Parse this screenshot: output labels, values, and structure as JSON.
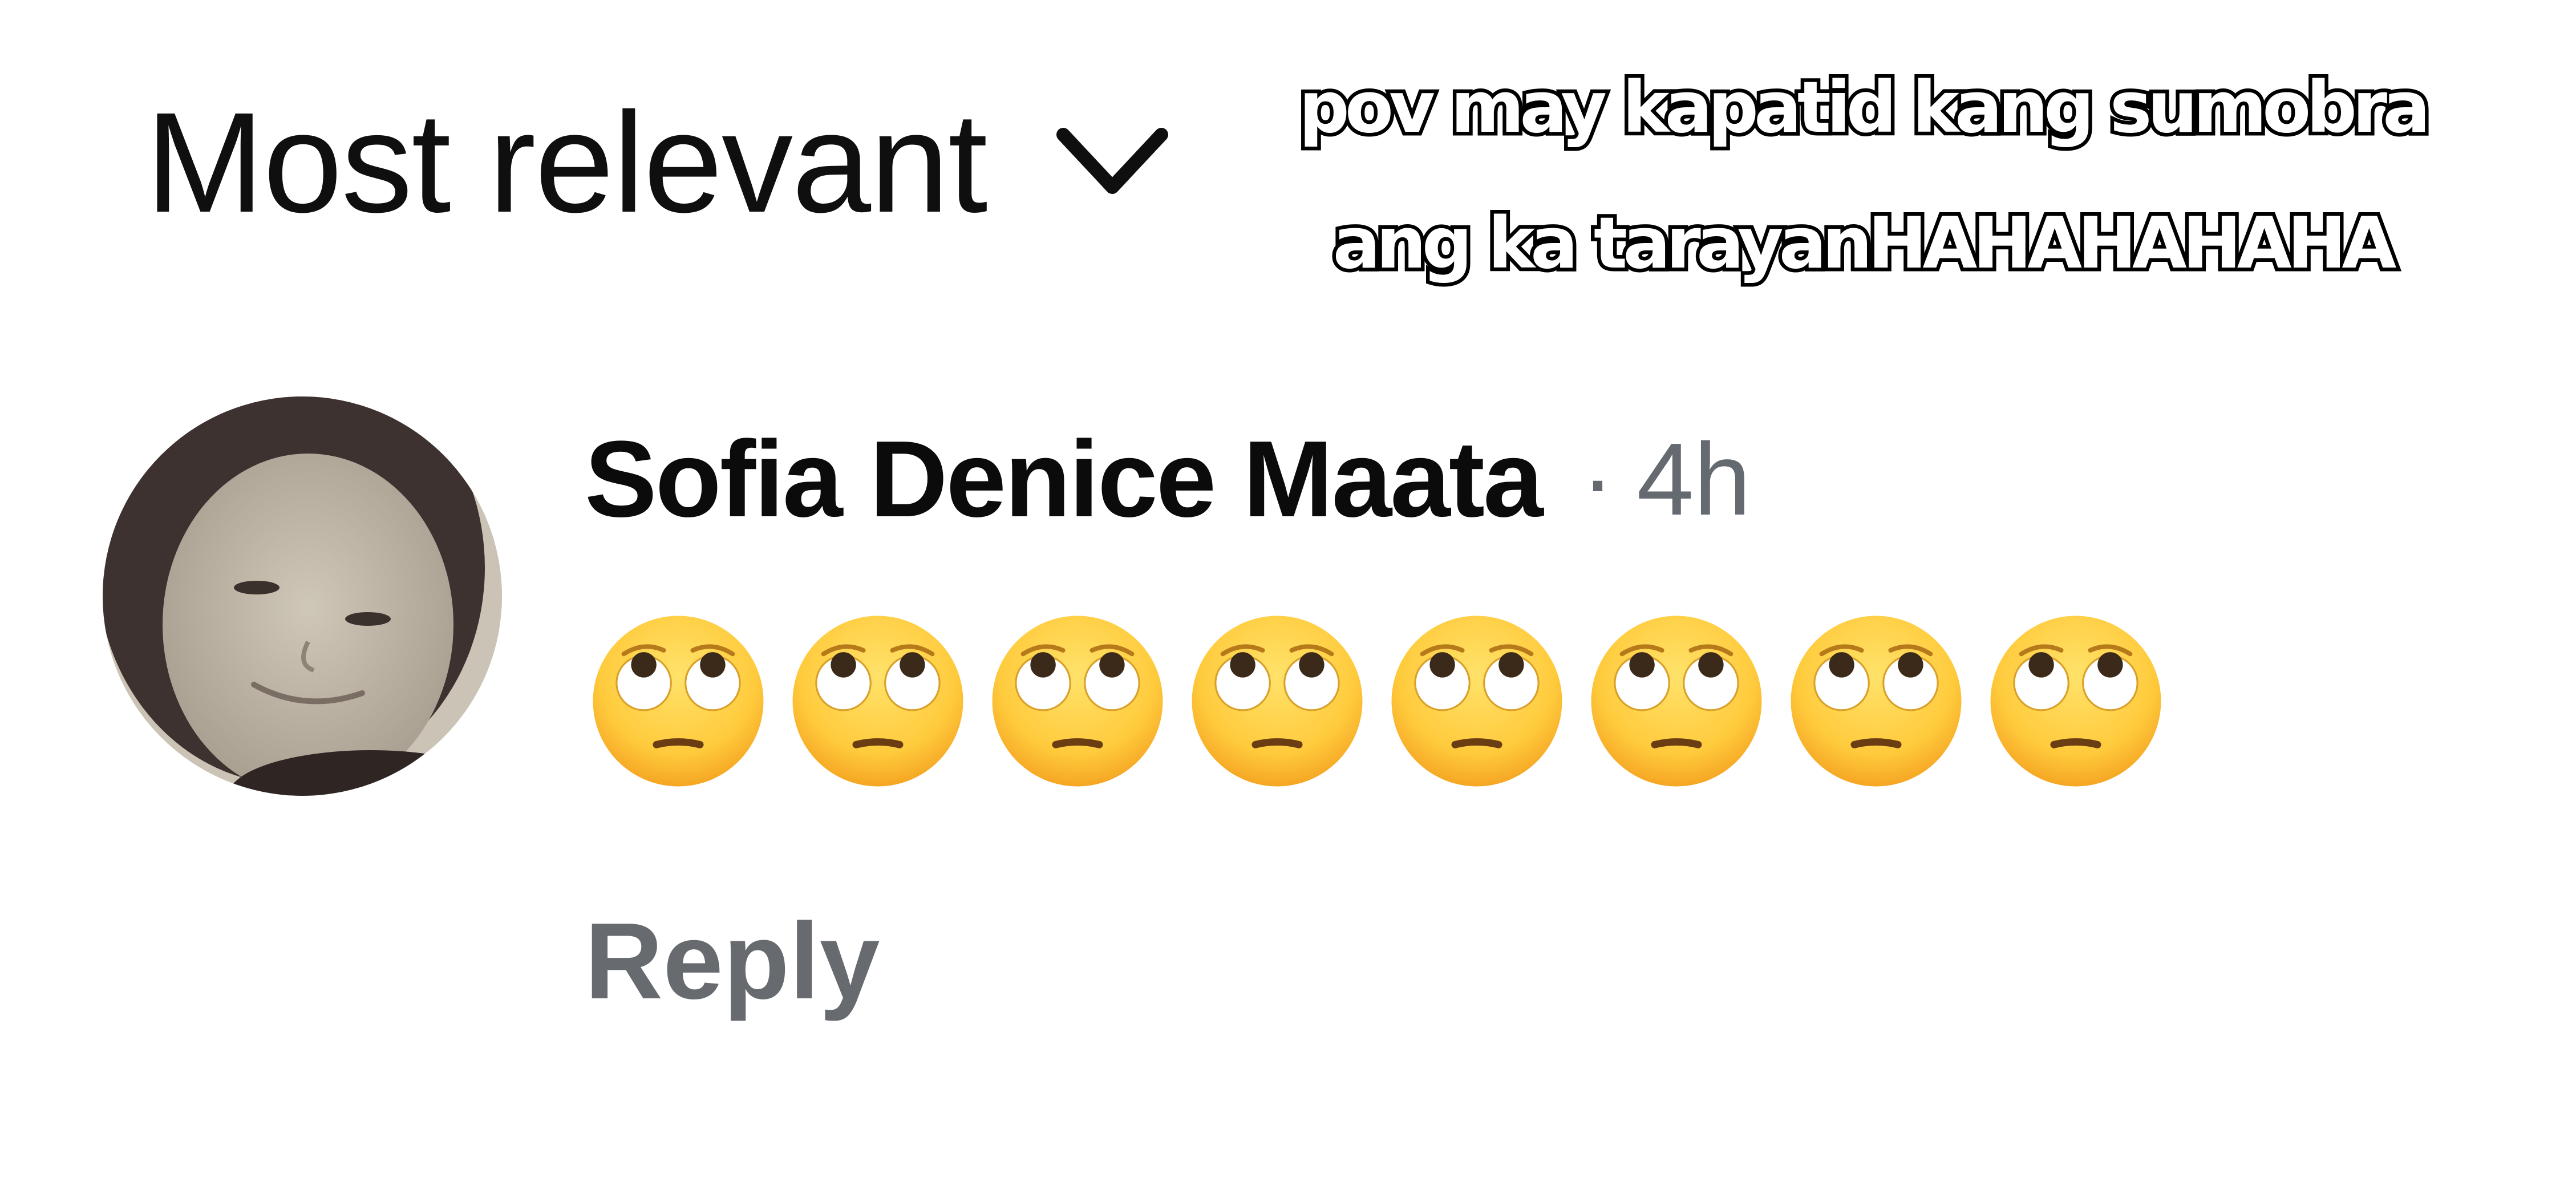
{
  "sort": {
    "label": "Most relevant",
    "icon": "chevron-down-icon"
  },
  "caption": {
    "line1": "pov may kapatid kang sumobra",
    "line2": "ang ka tarayanHAHAHAHAHA"
  },
  "comment": {
    "author": "Sofia Denice Maata",
    "separator": "·",
    "time": "4h",
    "emoji_count": 8,
    "emoji_name": "face-with-rolling-eyes",
    "reply_label": "Reply"
  },
  "colors": {
    "text_primary": "#0b0b0b",
    "text_secondary": "#656a70",
    "emoji_yellow": "#FFCB3D"
  }
}
